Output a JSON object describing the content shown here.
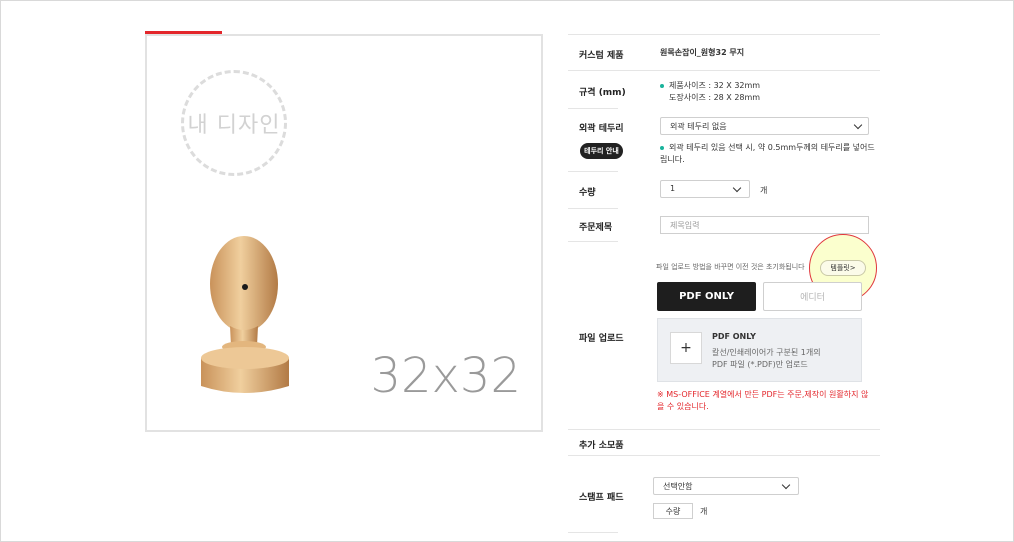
{
  "preview": {
    "badge": "내 디자인",
    "size_label": "32x32"
  },
  "form": {
    "product": {
      "label": "커스텀 제품",
      "value": "원목손잡이_원형32 무지"
    },
    "spec": {
      "label": "규격 (mm)",
      "line1": "제품사이즈 : 32 X 32mm",
      "line2": "도장사이즈 : 28 X 28mm"
    },
    "border": {
      "label": "외곽 테두리",
      "guide_button": "테두리 안내",
      "selected": "외곽 테두리 없음",
      "note_line1": "외곽 테두리 있음 선택 시, 약 0.5mm두께의 테두리를 넣어드",
      "note_line2": "립니다."
    },
    "quantity": {
      "label": "수량",
      "selected": "1",
      "unit": "개"
    },
    "order_title": {
      "label": "주문제목",
      "placeholder": "제목입력"
    },
    "upload": {
      "label": "파일 업로드",
      "notice": "파일 업로드 방법을 바꾸면 이전 것은 초기화됩니다",
      "template_button": "템플릿>",
      "tab_pdf": "PDF ONLY",
      "tab_editor": "에디터",
      "box_title": "PDF ONLY",
      "box_line1": "칼선/인쇄레이어가 구분된 1개의",
      "box_line2": "PDF 파일 (*.PDF)만 업로드",
      "plus": "+",
      "warning": "※ MS-OFFICE 계열에서 만든 PDF는 주문,제작이 원활하지 않을 수 있습니다."
    },
    "extras": {
      "label": "추가 소모품"
    },
    "stamp_pad": {
      "label": "스탬프 패드",
      "selected": "선택안함",
      "qty_placeholder": "수량",
      "unit": "개"
    }
  },
  "colors": {
    "accent_red": "#e3262b",
    "bullet_teal": "#19b39b",
    "dark_button": "#1e1e1e"
  }
}
